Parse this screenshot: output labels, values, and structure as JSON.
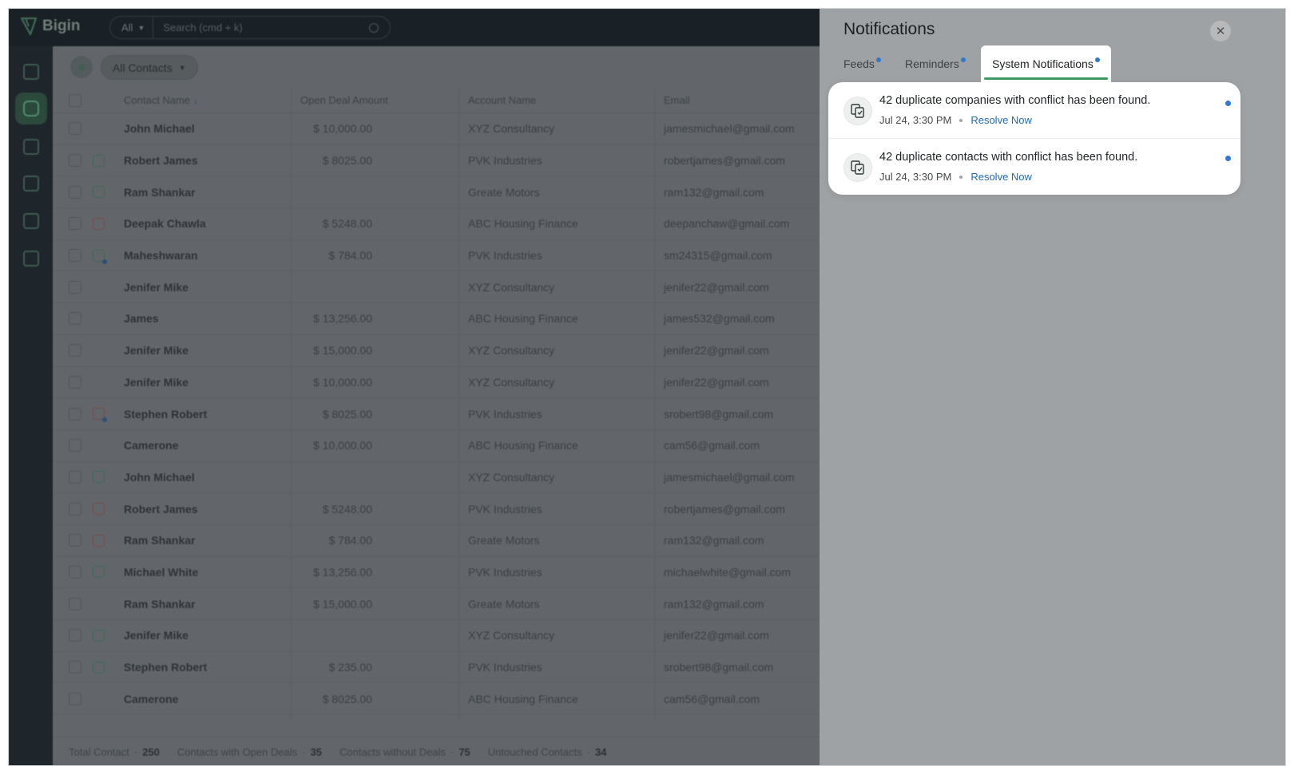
{
  "app": {
    "logo_text": "Bigin",
    "search_scope": "All",
    "search_placeholder": "Search (cmd + k)"
  },
  "toolbar": {
    "view_label": "All Contacts"
  },
  "table": {
    "columns": [
      "Contact Name",
      "Open Deal Amount",
      "Account Name",
      "Email"
    ],
    "rows": [
      {
        "name": "John Michael",
        "amount": "$ 10,000.00",
        "account": "XYZ Consultancy",
        "email": "jamesmichael@gmail.com",
        "task": ""
      },
      {
        "name": "Robert James",
        "amount": "$ 8025.00",
        "account": "PVK Industries",
        "email": "robertjames@gmail.com",
        "task": "green"
      },
      {
        "name": "Ram Shankar",
        "amount": "",
        "account": "Greate Motors",
        "email": "ram132@gmail.com",
        "task": "green"
      },
      {
        "name": "Deepak Chawla",
        "amount": "$ 5248.00",
        "account": "ABC Housing Finance",
        "email": "deepanchaw@gmail.com",
        "task": "red"
      },
      {
        "name": "Maheshwaran",
        "amount": "$ 784.00",
        "account": "PVK Industries",
        "email": "sm24315@gmail.com",
        "task": "green-dot"
      },
      {
        "name": "Jenifer Mike",
        "amount": "",
        "account": "XYZ Consultancy",
        "email": "jenifer22@gmail.com",
        "task": ""
      },
      {
        "name": "James",
        "amount": "$ 13,256.00",
        "account": "ABC Housing Finance",
        "email": "james532@gmail.com",
        "task": ""
      },
      {
        "name": "Jenifer Mike",
        "amount": "$ 15,000.00",
        "account": "XYZ Consultancy",
        "email": "jenifer22@gmail.com",
        "task": ""
      },
      {
        "name": "Jenifer Mike",
        "amount": "$ 10,000.00",
        "account": "XYZ Consultancy",
        "email": "jenifer22@gmail.com",
        "task": ""
      },
      {
        "name": "Stephen Robert",
        "amount": "$ 8025.00",
        "account": "PVK Industries",
        "email": "srobert98@gmail.com",
        "task": "red-dot"
      },
      {
        "name": "Camerone",
        "amount": "$ 10,000.00",
        "account": "ABC Housing Finance",
        "email": "cam56@gmail.com",
        "task": ""
      },
      {
        "name": "John Michael",
        "amount": "",
        "account": "XYZ Consultancy",
        "email": "jamesmichael@gmail.com",
        "task": "green"
      },
      {
        "name": "Robert James",
        "amount": "$ 5248.00",
        "account": "PVK Industries",
        "email": "robertjames@gmail.com",
        "task": "red"
      },
      {
        "name": "Ram Shankar",
        "amount": "$ 784.00",
        "account": "Greate Motors",
        "email": "ram132@gmail.com",
        "task": "red"
      },
      {
        "name": "Michael White",
        "amount": "$ 13,256.00",
        "account": "PVK Industries",
        "email": "michaelwhite@gmail.com",
        "task": "green"
      },
      {
        "name": "Ram Shankar",
        "amount": "$ 15,000.00",
        "account": "Greate Motors",
        "email": "ram132@gmail.com",
        "task": ""
      },
      {
        "name": "Jenifer Mike",
        "amount": "",
        "account": "XYZ Consultancy",
        "email": "jenifer22@gmail.com",
        "task": "green"
      },
      {
        "name": "Stephen Robert",
        "amount": "$ 235.00",
        "account": "PVK Industries",
        "email": "srobert98@gmail.com",
        "task": "green"
      },
      {
        "name": "Camerone",
        "amount": "$ 8025.00",
        "account": "ABC Housing Finance",
        "email": "cam56@gmail.com",
        "task": ""
      }
    ]
  },
  "footer": {
    "stats": [
      {
        "label": "Total Contact",
        "value": "250"
      },
      {
        "label": "Contacts with Open Deals",
        "value": "35"
      },
      {
        "label": "Contacts without Deals",
        "value": "75"
      },
      {
        "label": "Untouched Contacts",
        "value": "34"
      }
    ]
  },
  "notifications": {
    "title": "Notifications",
    "close_icon": "close-icon",
    "tabs": [
      {
        "label": "Feeds",
        "unread": true,
        "active": false
      },
      {
        "label": "Reminders",
        "unread": true,
        "active": false
      },
      {
        "label": "System Notifications",
        "unread": true,
        "active": true
      }
    ],
    "items": [
      {
        "text": "42 duplicate companies with conflict has been found.",
        "time": "Jul 24, 3:30 PM",
        "action": "Resolve Now",
        "icon": "duplicate-icon",
        "unread": true
      },
      {
        "text": "42 duplicate contacts with conflict has been found.",
        "time": "Jul 24, 3:30 PM",
        "action": "Resolve Now",
        "icon": "duplicate-icon",
        "unread": true
      }
    ],
    "accent_color": "#3e9b63",
    "link_color": "#1f6ab5",
    "unread_color": "#2e7ad0"
  }
}
